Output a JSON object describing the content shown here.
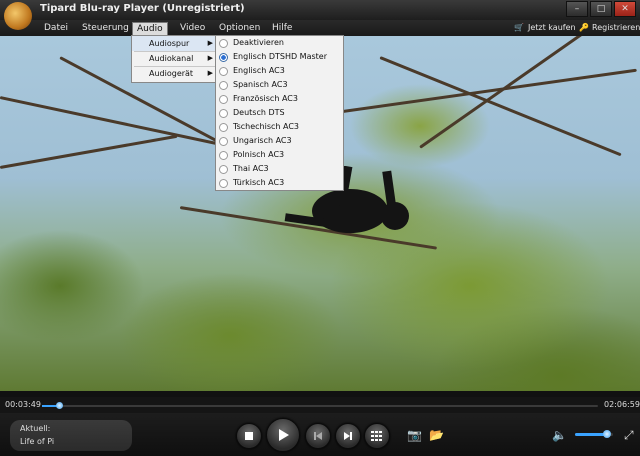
{
  "window": {
    "title": "Tipard Blu-ray Player (Unregistriert)"
  },
  "menubar": {
    "items": [
      "Datei",
      "Steuerung",
      "Audio",
      "Video",
      "Optionen",
      "Hilfe"
    ],
    "active": "Audio",
    "buy_label": "Jetzt kaufen",
    "register_label": "Registrieren"
  },
  "audio_menu": {
    "items": [
      "Audiospur",
      "Audiokanal",
      "Audiogerät"
    ],
    "highlighted": "Audiospur"
  },
  "audio_tracks": {
    "items": [
      "Deaktivieren",
      "Englisch DTSHD Master",
      "Englisch AC3",
      "Spanisch AC3",
      "Französisch AC3",
      "Deutsch DTS",
      "Tschechisch AC3",
      "Ungarisch AC3",
      "Polnisch AC3",
      "Thai AC3",
      "Türkisch AC3"
    ],
    "selected_index": 1
  },
  "playback": {
    "current_time": "00:03:49",
    "total_time": "02:06:59",
    "progress_fraction": 0.03,
    "volume_fraction": 0.85
  },
  "now_playing": {
    "label": "Aktuell:",
    "title": "Life of Pi"
  },
  "colors": {
    "accent": "#3aa3ff",
    "menu_bg": "#f2f2f2",
    "bar_bg": "#1a1a1a"
  }
}
